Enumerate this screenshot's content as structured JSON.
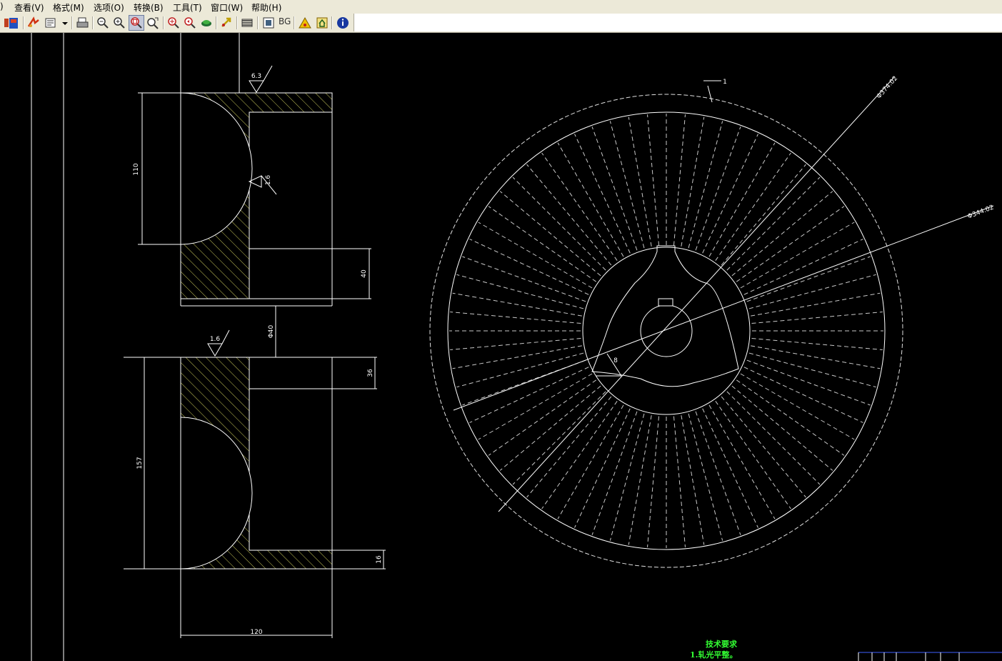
{
  "menu": [
    ")",
    "查看(V)",
    "格式(M)",
    "选项(O)",
    "转换(B)",
    "工具(T)",
    "窗口(W)",
    "帮助(H)"
  ],
  "toolbar": {
    "bg_label": "BG"
  },
  "drawing": {
    "dims": {
      "d_110": "110",
      "d_40": "40",
      "d_640": "Φ40",
      "d_36": "36",
      "d_157": "157",
      "d_16": "16",
      "d_120": "120",
      "roughness_63": "6.3",
      "roughness_16a": "1.6",
      "roughness_16b": "1.6",
      "outer_dia": "Φ374.02",
      "inner_dia": "Φ344.02",
      "tick_1": "1",
      "radial_8": "8"
    },
    "tech_title": "技术要求",
    "tech_note": "1.轧光平整。"
  },
  "colors": {
    "line": "#ffffff",
    "hatch": "#c8c85a",
    "dash": "#c8c8c8",
    "note": "#33ff33"
  }
}
